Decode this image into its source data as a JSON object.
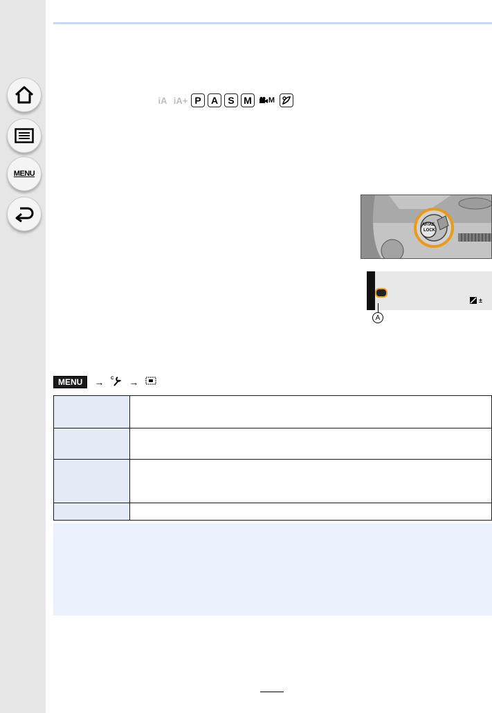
{
  "sidebar": {
    "items": [
      {
        "name": "home",
        "icon": "home-icon"
      },
      {
        "name": "contents",
        "icon": "list-icon"
      },
      {
        "name": "menu",
        "icon": "menu-icon",
        "label": "MENU"
      },
      {
        "name": "back",
        "icon": "back-arrow-icon"
      }
    ]
  },
  "modes": {
    "ia": "iA",
    "ia_plus": "iA+",
    "p": "P",
    "a": "A",
    "s": "S",
    "m": "M",
    "video": "M"
  },
  "figure": {
    "button_label_1": "AF/AE",
    "button_label_2": "LOCK",
    "callout": "A"
  },
  "menu_path": {
    "menu_tag": "MENU",
    "separator": "→"
  },
  "table": {
    "rows": [
      {
        "label": "",
        "value": ""
      },
      {
        "label": "",
        "value": ""
      },
      {
        "label": "",
        "value": ""
      },
      {
        "label": "",
        "value": ""
      }
    ]
  },
  "colors": {
    "sidebar_bg": "#e6e6e6",
    "rule": "#c9d8f0",
    "table_head_bg": "#e4eaf6",
    "notes_bg": "#eaf1fc",
    "highlight": "#f0a020"
  }
}
